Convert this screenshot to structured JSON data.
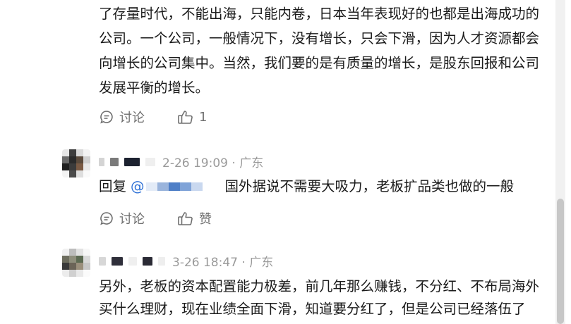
{
  "first_comment": {
    "lines": [
      "了存量时代，不能出海，只能内卷，日本当年表现好的也都是出海成功的",
      "公司。一个公司，一般情况下，没有增长，只会下滑，因为人才资源都会",
      "向增长的公司集中。当然，我们要的是有质量的增长，是股东回报和公司",
      "发展平衡的增长。"
    ],
    "discuss_label": "讨论",
    "like_label": "1"
  },
  "reply_comment": {
    "meta": "2-26 19:09 · 广东",
    "reply_prefix": "回复",
    "mention_at": "@",
    "text": "国外据说不需要大吸力，老板扩品类也做的一般",
    "discuss_label": "讨论",
    "like_label": "赞"
  },
  "third_comment": {
    "meta": "3-26 18:47 · 广东",
    "lines": [
      "另外，老板的资本配置能力极差，前几年那么赚钱，不分红、不布局海外",
      "买什么理财，现在业绩全面下滑，知道要分红了，但是公司已经落伍了"
    ]
  },
  "colors": {
    "text": "#1a1a1a",
    "meta": "#9a9a9a",
    "action": "#6f6f6f",
    "mention": "#2b6fd6"
  },
  "icons": [
    "comment-bubble-icon",
    "thumbs-up-icon"
  ]
}
